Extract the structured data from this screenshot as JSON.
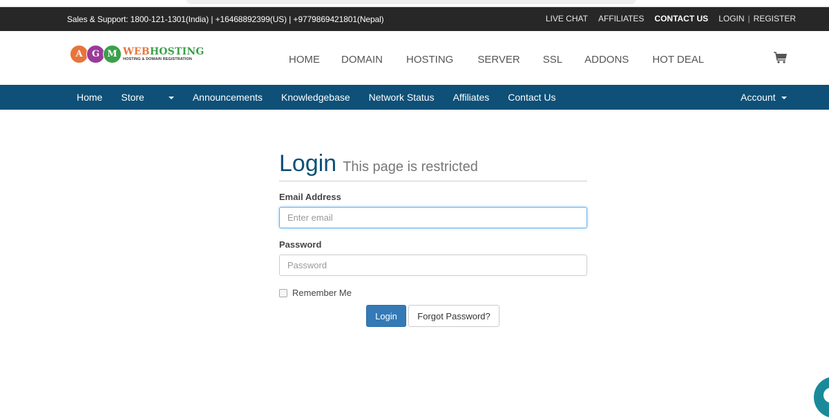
{
  "topbar": {
    "support_text": "Sales & Support: 1800-121-1301(India) | +16468892399(US) | +9779869421801(Nepal)",
    "links": {
      "live_chat": "LIVE CHAT",
      "affiliates": "AFFILIATES",
      "contact_us": "CONTACT US",
      "login": "LOGIN",
      "separator": "|",
      "register": "REGISTER"
    }
  },
  "logo": {
    "letters": [
      "A",
      "G",
      "M"
    ],
    "brand_web": "WEB",
    "brand_hosting": "HOSTING",
    "tagline": "HOSTING & DOMAIN REGISTRATION"
  },
  "main_nav": {
    "items": [
      "HOME",
      "DOMAIN",
      "HOSTING",
      "SERVER",
      "SSL",
      "ADDONS",
      "HOT DEAL"
    ],
    "cart_icon": "shopping-cart-icon"
  },
  "sub_nav": {
    "items": [
      "Home",
      "Store",
      "Announcements",
      "Knowledgebase",
      "Network Status",
      "Affiliates",
      "Contact Us"
    ],
    "account": "Account"
  },
  "login": {
    "title": "Login",
    "subtitle": "This page is restricted",
    "email_label": "Email Address",
    "email_placeholder": "Enter email",
    "email_value": "",
    "password_label": "Password",
    "password_placeholder": "Password",
    "password_value": "",
    "remember_label": "Remember Me",
    "remember_checked": false,
    "login_button": "Login",
    "forgot_button": "Forgot Password?"
  },
  "colors": {
    "topbar_bg": "#272727",
    "subnav_bg": "#0e5077",
    "primary_button": "#337ab7",
    "title_color": "#0e5077",
    "chat_widget": "#1a8a9a"
  }
}
